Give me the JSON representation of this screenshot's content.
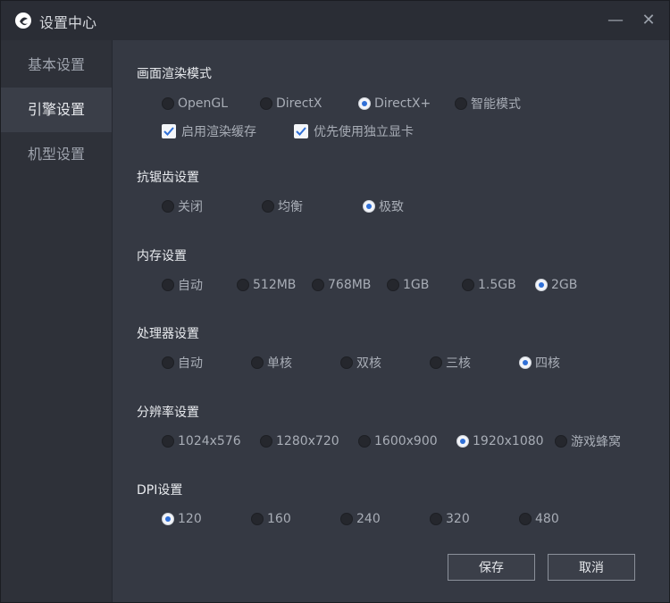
{
  "window": {
    "title": "设置中心"
  },
  "sidebar": {
    "items": [
      {
        "label": "基本设置",
        "active": false
      },
      {
        "label": "引擎设置",
        "active": true
      },
      {
        "label": "机型设置",
        "active": false
      }
    ]
  },
  "render": {
    "title": "画面渲染模式",
    "options": [
      "OpenGL",
      "DirectX",
      "DirectX+",
      "智能模式"
    ],
    "selected": 2,
    "checks": [
      {
        "label": "启用渲染缓存",
        "checked": true
      },
      {
        "label": "优先使用独立显卡",
        "checked": true
      }
    ]
  },
  "aa": {
    "title": "抗锯齿设置",
    "options": [
      "关闭",
      "均衡",
      "极致"
    ],
    "selected": 2
  },
  "mem": {
    "title": "内存设置",
    "options": [
      "自动",
      "512MB",
      "768MB",
      "1GB",
      "1.5GB",
      "2GB"
    ],
    "selected": 5
  },
  "cpu": {
    "title": "处理器设置",
    "options": [
      "自动",
      "单核",
      "双核",
      "三核",
      "四核"
    ],
    "selected": 4
  },
  "res": {
    "title": "分辨率设置",
    "options": [
      "1024x576",
      "1280x720",
      "1600x900",
      "1920x1080",
      "游戏蜂窝"
    ],
    "selected": 3
  },
  "dpi": {
    "title": "DPI设置",
    "options": [
      "120",
      "160",
      "240",
      "320",
      "480"
    ],
    "selected": 0
  },
  "buttons": {
    "save": "保存",
    "cancel": "取消"
  },
  "colors": {
    "accent": "#2f6fd6",
    "bg": "#353943",
    "sidebar": "#2e3139"
  }
}
